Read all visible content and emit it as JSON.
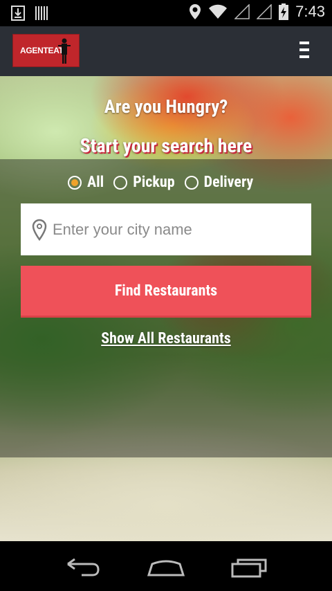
{
  "status_bar": {
    "time": "7:43",
    "icons": [
      "download-icon",
      "barcode-icon",
      "location-icon",
      "wifi-icon",
      "signal-icon",
      "signal-icon",
      "battery-charging-icon"
    ]
  },
  "app_bar": {
    "logo_text": "AGENTEAT",
    "menu_icon": "hamburger-menu-icon"
  },
  "hero": {
    "title": "Are you Hungry?",
    "subtitle": "Start your search here",
    "order_types": [
      {
        "label": "All",
        "selected": true
      },
      {
        "label": "Pickup",
        "selected": false
      },
      {
        "label": "Delivery",
        "selected": false
      }
    ],
    "city_input": {
      "value": "",
      "placeholder": "Enter your city name",
      "icon": "map-pin-icon"
    },
    "find_button_label": "Find Restaurants",
    "show_all_label": "Show All Restaurants"
  },
  "nav_bar": {
    "buttons": [
      "back-icon",
      "home-icon",
      "recent-apps-icon"
    ]
  },
  "colors": {
    "app_bar": "#2b2f36",
    "logo_red": "#c0262b",
    "button_red": "#ef5159",
    "radio_checked": "#f0a22b"
  }
}
